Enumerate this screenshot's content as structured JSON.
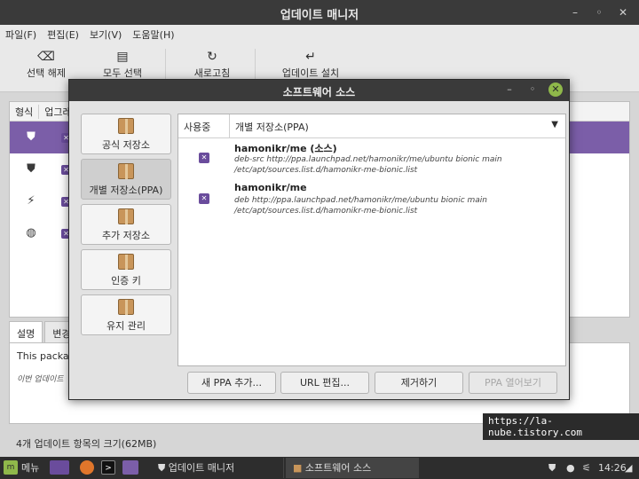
{
  "main_window": {
    "title": "업데이트 매니저",
    "menu": [
      "파일(F)",
      "편집(E)",
      "보기(V)",
      "도움말(H)"
    ],
    "toolbar": {
      "clear_label": "선택 해제",
      "select_all_label": "모두 선택",
      "refresh_label": "새로고침",
      "install_label": "업데이트 설치"
    },
    "columns": [
      "형식",
      "업그레"
    ],
    "desc_tabs": [
      "설명",
      "변경"
    ],
    "desc_text": "This packag",
    "desc_note": "이번 업데이트",
    "status": "4개 업데이트 항목의 크기(62MB)"
  },
  "dialog": {
    "title": "소프트웨어 소스",
    "sidebar": [
      {
        "label": "공식 저장소"
      },
      {
        "label": "개별 저장소(PPA)"
      },
      {
        "label": "추가 저장소"
      },
      {
        "label": "인증 키"
      },
      {
        "label": "유지 관리"
      }
    ],
    "enabled_col": "사용중",
    "selected_source": "개별 저장소(PPA)",
    "ppas": [
      {
        "name": "hamonikr/me (소스)",
        "line1": "deb-src http://ppa.launchpad.net/hamonikr/me/ubuntu bionic main",
        "line2": "/etc/apt/sources.list.d/hamonikr-me-bionic.list"
      },
      {
        "name": "hamonikr/me",
        "line1": "deb http://ppa.launchpad.net/hamonikr/me/ubuntu bionic main",
        "line2": "/etc/apt/sources.list.d/hamonikr-me-bionic.list"
      }
    ],
    "buttons": {
      "add": "새 PPA 추가...",
      "edit": "URL 편집...",
      "remove": "제거하기",
      "open": "PPA 열어보기"
    }
  },
  "watermark": "https://la-nube.tistory.com",
  "taskbar": {
    "menu_label": "메뉴",
    "task1": "업데이트 매니저",
    "task2": "소프트웨어 소스",
    "clock": "14:26"
  },
  "colors": {
    "accent_purple": "#7b5ea8",
    "close_green": "#8fb84a"
  }
}
